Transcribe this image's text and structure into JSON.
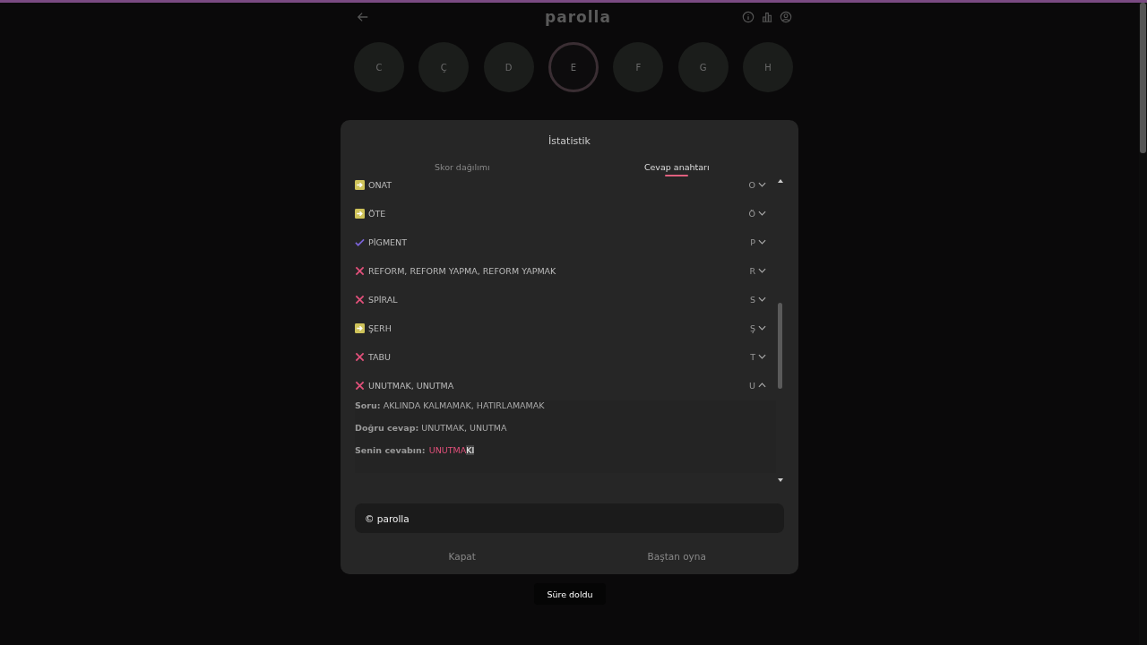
{
  "header": {
    "title": "parolla"
  },
  "letters": [
    {
      "label": "C",
      "selected": false
    },
    {
      "label": "Ç",
      "selected": false
    },
    {
      "label": "D",
      "selected": false
    },
    {
      "label": "E",
      "selected": true
    },
    {
      "label": "F",
      "selected": false
    },
    {
      "label": "G",
      "selected": false
    },
    {
      "label": "H",
      "selected": false
    }
  ],
  "dialog": {
    "title": "İstatistik",
    "tabs": [
      {
        "label": "Skor dağılımı",
        "selected": false
      },
      {
        "label": "Cevap anahtarı",
        "selected": true
      }
    ],
    "answers": [
      {
        "kind": "pass",
        "word": "ONAT",
        "letter": "O",
        "expanded": false
      },
      {
        "kind": "pass",
        "word": "ÖTE",
        "letter": "Ö",
        "expanded": false
      },
      {
        "kind": "correct",
        "word": "PİGMENT",
        "letter": "P",
        "expanded": false
      },
      {
        "kind": "wrong",
        "word": "REFORM, REFORM YAPMA, REFORM YAPMAK",
        "letter": "R",
        "expanded": false
      },
      {
        "kind": "wrong",
        "word": "SPİRAL",
        "letter": "S",
        "expanded": false
      },
      {
        "kind": "pass",
        "word": "ŞERH",
        "letter": "Ş",
        "expanded": false
      },
      {
        "kind": "wrong",
        "word": "TABU",
        "letter": "T",
        "expanded": false
      },
      {
        "kind": "wrong",
        "word": "UNUTMAK, UNUTMA",
        "letter": "U",
        "expanded": true,
        "details": {
          "question": "**Soru:** AKLINDA KALMAMAK, HATIRLAMAMAK",
          "correct_answer": "**Doğru cevap:** UNUTMAK, UNUTMA",
          "your_answer_label": "Senin cevabın:",
          "your_answer": [
            {
              "text": "UNUTMA",
              "selected": false
            },
            {
              "text": "KI",
              "selected": true
            }
          ]
        }
      }
    ],
    "share_text": "© parolla",
    "buttons": [
      "Kapat",
      "Baştan oyna"
    ]
  },
  "toast": "Süre doldu"
}
